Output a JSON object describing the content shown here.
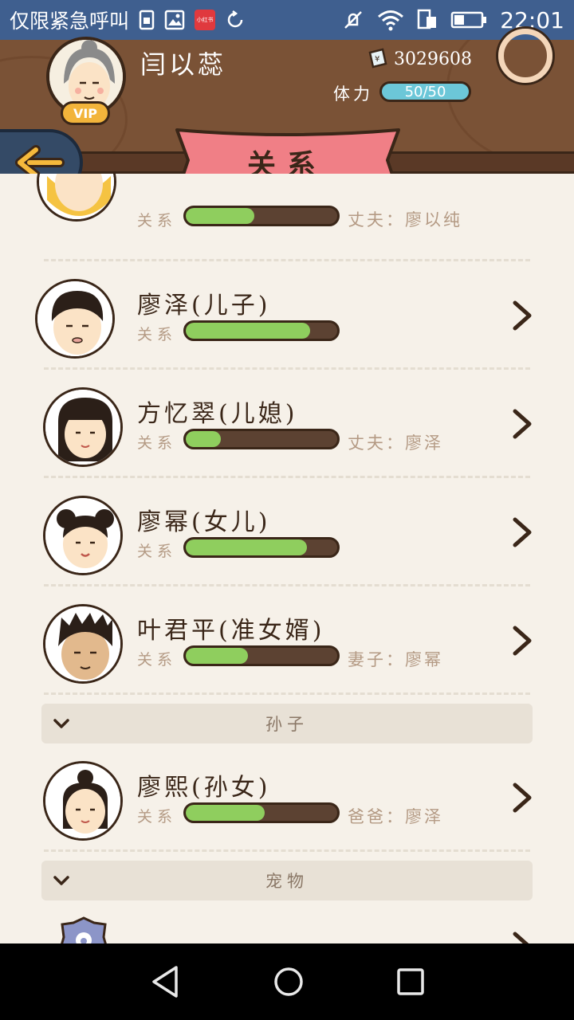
{
  "status_bar": {
    "carrier": "仅限紧急呼叫",
    "time": "22:01",
    "app_icon_text": "小红书"
  },
  "header": {
    "player_name": "闫以蕊",
    "vip_label": "VIP",
    "coins": "3029608",
    "stamina_label": "体力",
    "stamina_value": "50/50",
    "page_title": "关系"
  },
  "relations": [
    {
      "name": "",
      "relation_label": "关系",
      "progress": 0.45,
      "extra": "丈夫：廖以纯"
    },
    {
      "name": "廖泽(儿子)",
      "relation_label": "关系",
      "progress": 0.82,
      "extra": ""
    },
    {
      "name": "方忆翠(儿媳)",
      "relation_label": "关系",
      "progress": 0.23,
      "extra": "丈夫：廖泽"
    },
    {
      "name": "廖幂(女儿)",
      "relation_label": "关系",
      "progress": 0.8,
      "extra": ""
    },
    {
      "name": "叶君平(准女婿)",
      "relation_label": "关系",
      "progress": 0.41,
      "extra": "妻子：廖幂"
    }
  ],
  "sections": {
    "grandchildren": "孙子",
    "pets": "宠物"
  },
  "grandchildren": [
    {
      "name": "廖熙(孙女)",
      "relation_label": "关系",
      "progress": 0.52,
      "extra": "爸爸：廖泽"
    }
  ],
  "colors": {
    "wood": "#7a5236",
    "banner": "#f07f86",
    "progress_fill": "#8fce5e",
    "stamina": "#6cc7d8",
    "status_bar": "#3f5f8f"
  }
}
